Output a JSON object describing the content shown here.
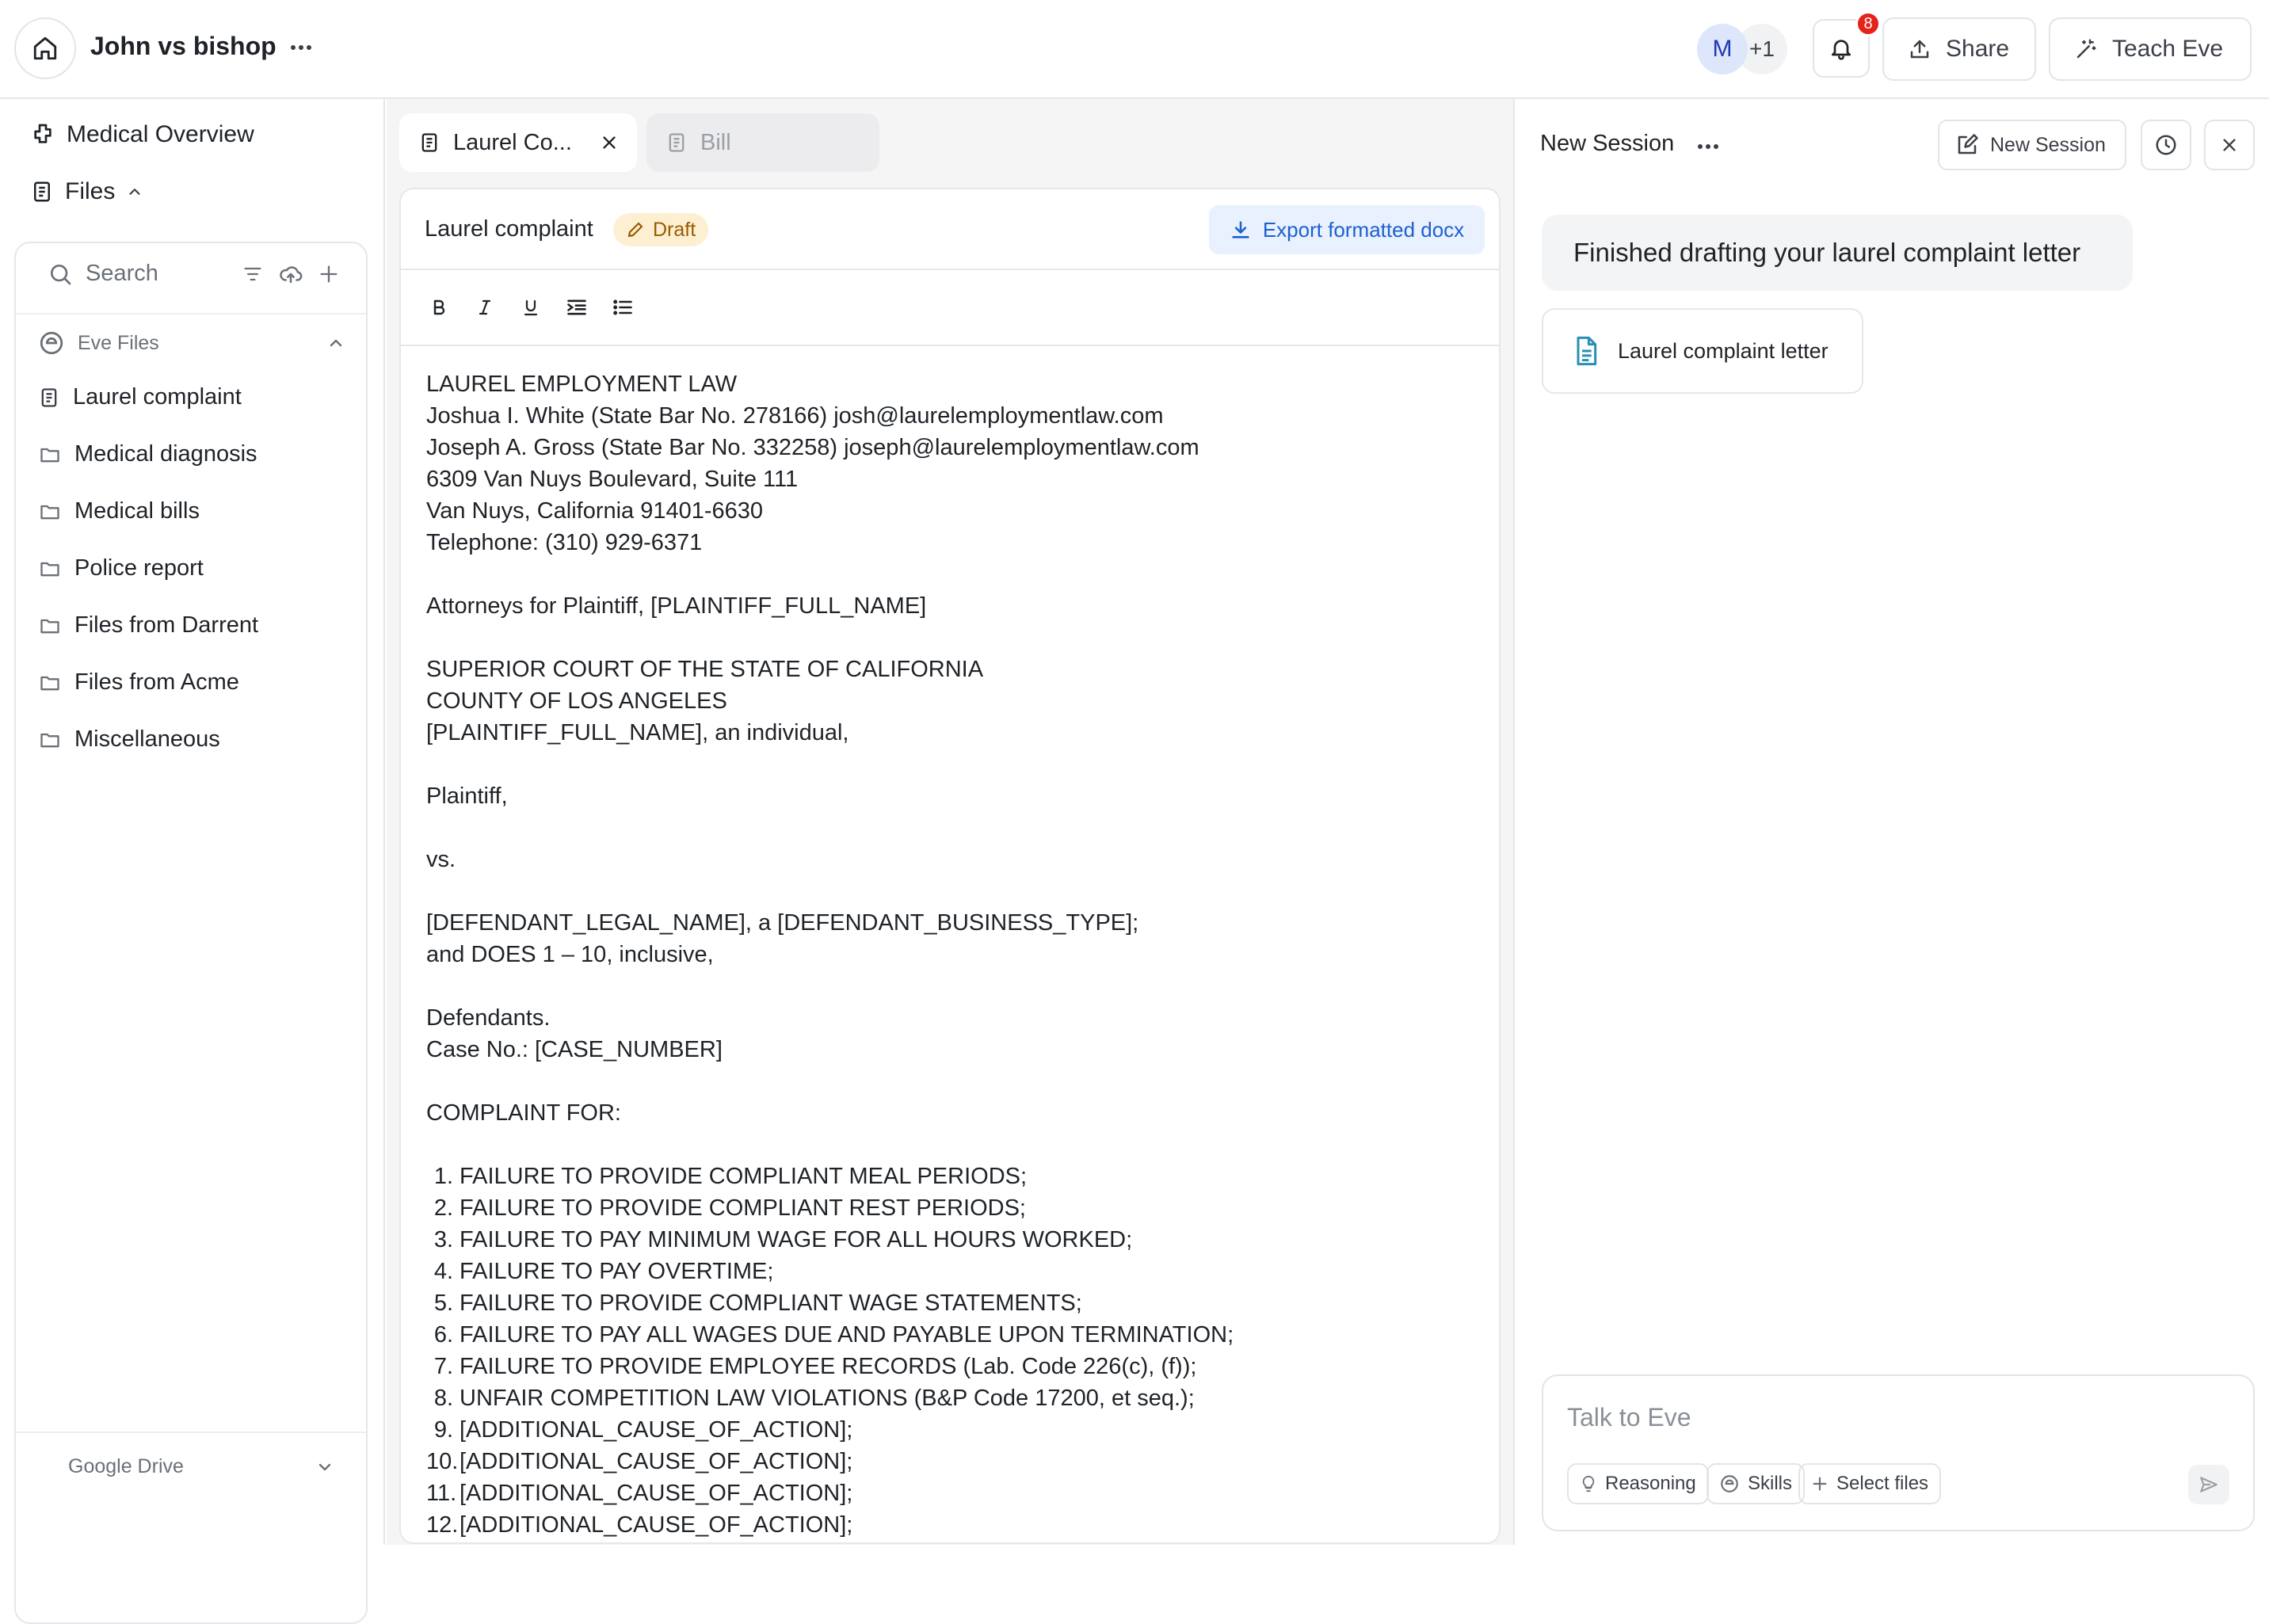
{
  "header": {
    "case_title": "John vs bishop",
    "avatar_initial": "M",
    "avatar_more": "+1",
    "notification_count": "8",
    "share_label": "Share",
    "teach_label": "Teach Eve"
  },
  "sidebar": {
    "overview_label": "Medical Overview",
    "files_label": "Files",
    "search_placeholder": "Search",
    "section_label": "Eve Files",
    "items": [
      {
        "label": "Laurel complaint",
        "icon": "document-icon"
      },
      {
        "label": "Medical diagnosis",
        "icon": "folder-icon"
      },
      {
        "label": "Medical bills",
        "icon": "folder-icon"
      },
      {
        "label": "Police report",
        "icon": "folder-icon"
      },
      {
        "label": "Files from Darrent",
        "icon": "folder-icon"
      },
      {
        "label": "Files from Acme",
        "icon": "folder-icon"
      },
      {
        "label": "Miscellaneous",
        "icon": "folder-icon"
      }
    ],
    "drive_label": "Google Drive"
  },
  "editor": {
    "tabs": [
      {
        "label": "Laurel Co...",
        "active": true
      },
      {
        "label": "Bill",
        "active": false
      }
    ],
    "doc_title": "Laurel complaint",
    "status_badge": "Draft",
    "export_label": "Export formatted docx",
    "lines_header": [
      "LAUREL EMPLOYMENT LAW",
      "Joshua I. White (State Bar No. 278166) josh@laurelemploymentlaw.com",
      "Joseph A. Gross (State Bar No. 332258) joseph@laurelemploymentlaw.com",
      "6309 Van Nuys Boulevard, Suite 111",
      "Van Nuys, California 91401-6630",
      "Telephone: (310) 929-6371"
    ],
    "attorneys_line": "Attorneys for Plaintiff, [PLAINTIFF_FULL_NAME]",
    "court_lines": [
      "SUPERIOR COURT OF THE STATE OF CALIFORNIA",
      "COUNTY OF LOS ANGELES",
      "[PLAINTIFF_FULL_NAME], an individual,"
    ],
    "plaintiff_line": "Plaintiff,",
    "vs_line": "vs.",
    "defendant_lines": [
      "[DEFENDANT_LEGAL_NAME], a [DEFENDANT_BUSINESS_TYPE];",
      "and DOES 1 – 10, inclusive,"
    ],
    "defendants_lines": [
      "Defendants.",
      "Case No.: [CASE_NUMBER]"
    ],
    "complaint_heading": "COMPLAINT FOR:",
    "causes": [
      "FAILURE TO PROVIDE COMPLIANT MEAL PERIODS;",
      "FAILURE TO PROVIDE COMPLIANT REST PERIODS;",
      "FAILURE TO PAY MINIMUM WAGE FOR ALL HOURS WORKED;",
      "FAILURE TO PAY OVERTIME;",
      "FAILURE TO PROVIDE COMPLIANT WAGE STATEMENTS;",
      "FAILURE TO PAY ALL WAGES DUE AND PAYABLE UPON TERMINATION;",
      "FAILURE TO PROVIDE EMPLOYEE RECORDS (Lab. Code 226(c), (f));",
      "UNFAIR COMPETITION LAW VIOLATIONS (B&P Code 17200, et seq.);",
      "[ADDITIONAL_CAUSE_OF_ACTION];",
      "[ADDITIONAL_CAUSE_OF_ACTION];",
      "[ADDITIONAL_CAUSE_OF_ACTION];",
      "[ADDITIONAL_CAUSE_OF_ACTION];"
    ]
  },
  "chat": {
    "session_title": "New Session",
    "new_session_label": "New Session",
    "message": "Finished drafting your laurel complaint letter",
    "attachment_label": "Laurel complaint letter",
    "input_placeholder": "Talk to Eve",
    "chip_reasoning": "Reasoning",
    "chip_skills": "Skills",
    "chip_files": "Select files"
  },
  "colors": {
    "accent": "#1f5fd1",
    "badge_red": "#e5231b",
    "draft_bg": "#fdf0d2",
    "draft_text": "#9a5b00"
  }
}
